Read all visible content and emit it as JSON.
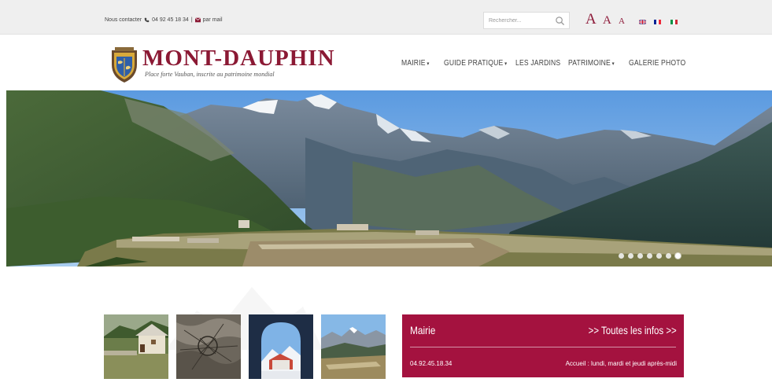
{
  "topbar": {
    "contact_label": "Nous contacter",
    "phone": "04 92 45 18 34",
    "separator": "|",
    "email_label": "par mail",
    "search_placeholder": "Rechercher...",
    "font_sizes": [
      "A",
      "A",
      "A"
    ],
    "languages": [
      "en",
      "fr",
      "it"
    ]
  },
  "header": {
    "brand": "MONT-DAUPHIN",
    "tagline": "Place forte Vauban, inscrite au patrimoine mondial",
    "nav": [
      {
        "label": "MAIRIE",
        "caret": "▾"
      },
      {
        "label": "GUIDE PRATIQUE",
        "caret": "▾"
      },
      {
        "label": "LES JARDINS",
        "caret": ""
      },
      {
        "label": "PATRIMOINE",
        "caret": "▾"
      },
      {
        "label": "GALERIE PHOTO",
        "caret": ""
      }
    ]
  },
  "slider": {
    "slide_count": 7,
    "active_index": 6
  },
  "info_box": {
    "title": "Mairie",
    "link": ">> Toutes les infos >>",
    "phone": "04.92.45.18.34",
    "hours": "Accueil : lundi, mardi et jeudi après-midi"
  },
  "colors": {
    "brand": "#8b1934",
    "info_bg": "#a4123f",
    "topbar_bg": "#efefef"
  }
}
